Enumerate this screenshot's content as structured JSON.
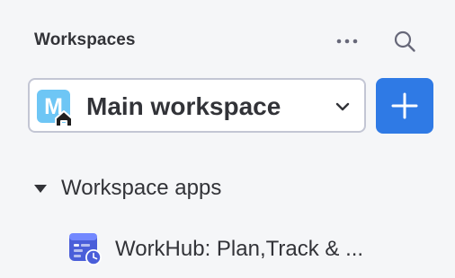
{
  "header": {
    "title": "Workspaces",
    "more_icon": "more-horizontal-icon",
    "search_icon": "search-icon"
  },
  "workspace_selector": {
    "avatar_letter": "M",
    "avatar_color": "#6ec6f5",
    "home_icon": "home-icon",
    "name": "Main workspace",
    "chevron_icon": "chevron-down-icon"
  },
  "add_button": {
    "icon": "plus-icon",
    "color": "#2f7ae5"
  },
  "section": {
    "label": "Workspace apps",
    "expanded": true,
    "items": [
      {
        "label": "WorkHub: Plan,Track & ...",
        "icon": "app-icon-calendar-clock"
      }
    ]
  }
}
